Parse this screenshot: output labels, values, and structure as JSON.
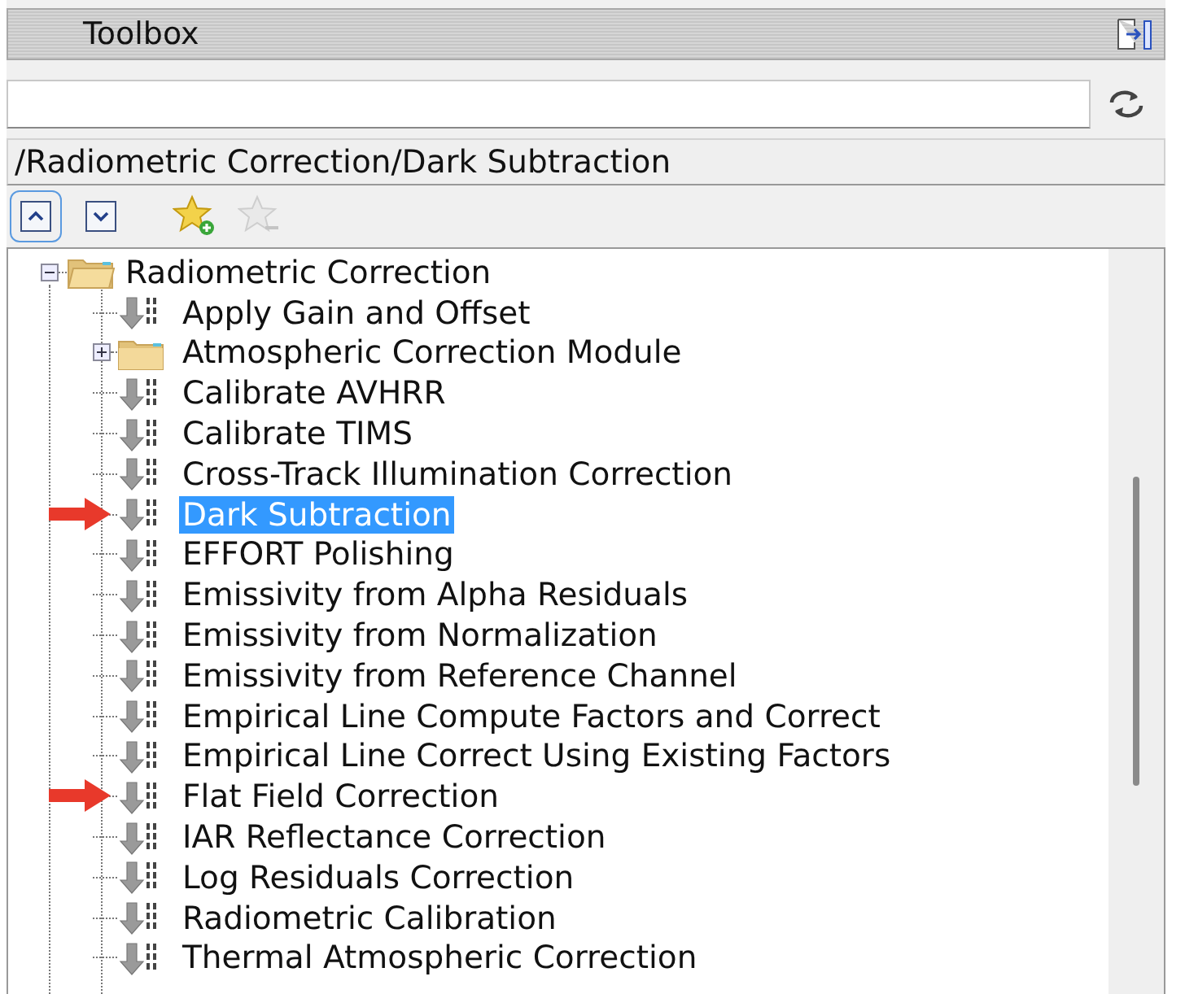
{
  "panel": {
    "title": "Toolbox"
  },
  "path": {
    "value": "/Radiometric Correction/Dark Subtraction"
  },
  "toolbar": [
    {
      "kind": "expand-up",
      "selected": true,
      "disabled": false
    },
    {
      "kind": "expand-down",
      "selected": false,
      "disabled": false
    },
    {
      "kind": "favorite-add",
      "selected": false,
      "disabled": false
    },
    {
      "kind": "favorite-remove",
      "selected": false,
      "disabled": true
    }
  ],
  "tree": [
    {
      "label": "Radiometric Correction",
      "kind": "folder",
      "expanded": true,
      "selected": false,
      "marked": false,
      "children": [
        {
          "label": "Apply Gain and Offset",
          "kind": "tool",
          "selected": false,
          "marked": false
        },
        {
          "label": "Atmospheric Correction Module",
          "kind": "folder",
          "expanded": false,
          "selected": false,
          "marked": false
        },
        {
          "label": "Calibrate AVHRR",
          "kind": "tool",
          "selected": false,
          "marked": false
        },
        {
          "label": "Calibrate TIMS",
          "kind": "tool",
          "selected": false,
          "marked": false
        },
        {
          "label": "Cross-Track Illumination Correction",
          "kind": "tool",
          "selected": false,
          "marked": false
        },
        {
          "label": "Dark Subtraction",
          "kind": "tool",
          "selected": true,
          "marked": true
        },
        {
          "label": "EFFORT Polishing",
          "kind": "tool",
          "selected": false,
          "marked": false
        },
        {
          "label": "Emissivity from Alpha Residuals",
          "kind": "tool",
          "selected": false,
          "marked": false
        },
        {
          "label": "Emissivity from Normalization",
          "kind": "tool",
          "selected": false,
          "marked": false
        },
        {
          "label": "Emissivity from Reference Channel",
          "kind": "tool",
          "selected": false,
          "marked": false
        },
        {
          "label": "Empirical Line Compute Factors and Correct",
          "kind": "tool",
          "selected": false,
          "marked": false
        },
        {
          "label": "Empirical Line Correct Using Existing Factors",
          "kind": "tool",
          "selected": false,
          "marked": false
        },
        {
          "label": "Flat Field Correction",
          "kind": "tool",
          "selected": false,
          "marked": true
        },
        {
          "label": "IAR Reflectance Correction",
          "kind": "tool",
          "selected": false,
          "marked": false
        },
        {
          "label": "Log Residuals Correction",
          "kind": "tool",
          "selected": false,
          "marked": false
        },
        {
          "label": "Radiometric Calibration",
          "kind": "tool",
          "selected": false,
          "marked": false
        },
        {
          "label": "Thermal Atmospheric Correction",
          "kind": "tool",
          "selected": false,
          "marked": false
        }
      ]
    }
  ]
}
